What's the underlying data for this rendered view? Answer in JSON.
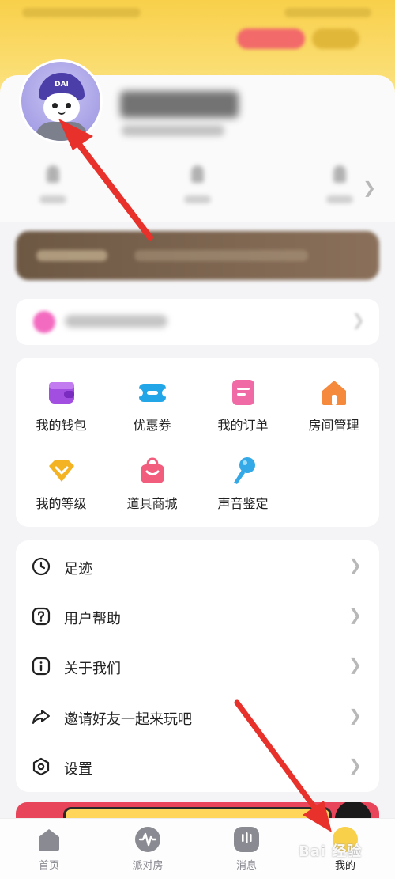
{
  "grid": {
    "items": [
      {
        "label": "我的钱包",
        "icon": "wallet-icon",
        "color": "#a24ee0"
      },
      {
        "label": "优惠券",
        "icon": "coupon-icon",
        "color": "#22a6e8"
      },
      {
        "label": "我的订单",
        "icon": "order-icon",
        "color": "#f06aa5"
      },
      {
        "label": "房间管理",
        "icon": "house-icon",
        "color": "#f58a3c"
      },
      {
        "label": "我的等级",
        "icon": "diamond-icon",
        "color": "#f4b323"
      },
      {
        "label": "道具商城",
        "icon": "shopping-bag-icon",
        "color": "#f25d7e"
      },
      {
        "label": "声音鉴定",
        "icon": "microphone-icon",
        "color": "#34a9e8"
      }
    ]
  },
  "menu": {
    "items": [
      {
        "label": "足迹",
        "icon": "clock-icon"
      },
      {
        "label": "用户帮助",
        "icon": "help-icon"
      },
      {
        "label": "关于我们",
        "icon": "info-icon"
      },
      {
        "label": "邀请好友一起来玩吧",
        "icon": "share-icon"
      },
      {
        "label": "设置",
        "icon": "settings-hexagon-icon"
      }
    ]
  },
  "tabbar": {
    "tabs": [
      {
        "label": "首页",
        "icon": "home-icon"
      },
      {
        "label": "派对房",
        "icon": "waveform-icon"
      },
      {
        "label": "消息",
        "icon": "message-icon"
      },
      {
        "label": "我的",
        "icon": "profile-icon",
        "active": true
      }
    ]
  },
  "avatar": {
    "badge": "DAI"
  },
  "watermark": {
    "text": "Bai 经验"
  },
  "colors": {
    "accent_yellow": "#f8d04a",
    "arrow_red": "#e8312a"
  }
}
